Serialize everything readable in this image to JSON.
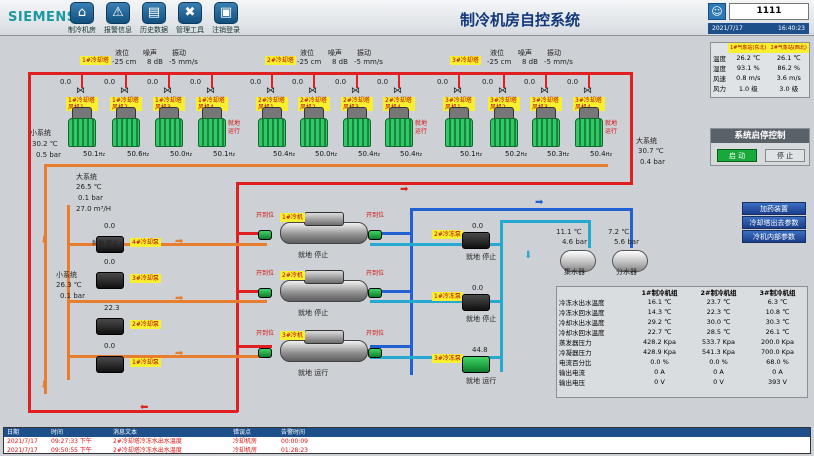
{
  "header": {
    "brand": "SIEMENS",
    "title": "制冷机房自控系统",
    "user": "1111",
    "date": "2021/7/17",
    "time": "16:40:23",
    "toolbar": [
      {
        "label": "制冷机房",
        "icon": "home-icon",
        "glyph": "⌂"
      },
      {
        "label": "报警信息",
        "icon": "warning-icon",
        "glyph": "⚠"
      },
      {
        "label": "历史数据",
        "icon": "folder-icon",
        "glyph": "▤"
      },
      {
        "label": "管理工具",
        "icon": "tools-icon",
        "glyph": "✖"
      },
      {
        "label": "注销登录",
        "icon": "lock-icon",
        "glyph": "▣"
      }
    ]
  },
  "groups": [
    {
      "name": "1#冷却塔",
      "level": "液位",
      "lvl_val": "-25 cm",
      "noise": "噪声",
      "noise_val": "8 dB",
      "vib": "振动",
      "vib_val": "-5 mm/s"
    },
    {
      "name": "2#冷却塔",
      "level": "液位",
      "lvl_val": "-25 cm",
      "noise": "噪声",
      "noise_val": "8 dB",
      "vib": "振动",
      "vib_val": "-5 mm/s"
    },
    {
      "name": "3#冷却塔",
      "level": "液位",
      "lvl_val": "-25 cm",
      "noise": "噪声",
      "noise_val": "8 dB",
      "vib": "振动",
      "vib_val": "-5 mm/s"
    }
  ],
  "towers": [
    {
      "label": "1#冷却塔风机1",
      "hz": "50.1",
      "valve": "0.0"
    },
    {
      "label": "1#冷却塔风机2",
      "hz": "50.6",
      "valve": "0.0"
    },
    {
      "label": "1#冷却塔风机3",
      "hz": "50.0",
      "valve": "0.0"
    },
    {
      "label": "1#冷却塔风机4",
      "hz": "50.1",
      "valve": "0.0"
    },
    {
      "label": "2#冷却塔风机1",
      "hz": "50.4",
      "valve": "0.0"
    },
    {
      "label": "2#冷却塔风机2",
      "hz": "50.0",
      "valve": "0.0"
    },
    {
      "label": "2#冷却塔风机3",
      "hz": "50.4",
      "valve": "0.0"
    },
    {
      "label": "2#冷却塔风机4",
      "hz": "50.4",
      "valve": "0.0"
    },
    {
      "label": "3#冷却塔风机1",
      "hz": "50.1",
      "valve": "0.0"
    },
    {
      "label": "3#冷却塔风机2",
      "hz": "50.2",
      "valve": "0.0"
    },
    {
      "label": "3#冷却塔风机3",
      "hz": "50.3",
      "valve": "0.0"
    },
    {
      "label": "3#冷却塔风机4",
      "hz": "50.4",
      "valve": "0.0"
    }
  ],
  "status_local": "就地",
  "status_run": "运行",
  "hz_unit": "Hz",
  "left_side": {
    "label": "小系统",
    "temp": "30.2 ℃",
    "pres": "0.5 bar"
  },
  "right_side": {
    "label": "大系统",
    "temp": "30.7 ℃",
    "pres": "0.4 bar"
  },
  "big_sys": {
    "label": "大系统",
    "temp": "26.5 ℃",
    "pres": "0.1 bar",
    "flow": "27.0 m³/H"
  },
  "small_sys": {
    "label": "小系统",
    "temp": "26.3 ℃",
    "pres": "0.1 bar"
  },
  "cw_pumps": [
    {
      "label": "4#冷却泵",
      "hz": "0.0",
      "state": "就地  停止"
    },
    {
      "label": "3#冷却泵",
      "hz": "0.0",
      "state": ""
    },
    {
      "label": "2#冷却泵",
      "hz": "22.3",
      "state": ""
    },
    {
      "label": "1#冷却泵",
      "hz": "0.0",
      "state": ""
    }
  ],
  "chillers": [
    {
      "label": "1#冷机",
      "state": "就地  停止"
    },
    {
      "label": "2#冷机",
      "state": "就地  停止"
    },
    {
      "label": "3#冷机",
      "state": "就地  运行"
    }
  ],
  "valve_open": "开到位",
  "chw_pumps": [
    {
      "label": "2#冷冻泵",
      "hz": "0.0",
      "state": "就地  停止"
    },
    {
      "label": "1#冷冻泵",
      "hz": "0.0",
      "state": "就地  停止"
    },
    {
      "label": "3#冷冻泵",
      "hz": "44.8",
      "state": "就地  运行"
    }
  ],
  "tanks": [
    {
      "label": "集水器",
      "temp": "11.1 ℃",
      "pres": "4.6 bar"
    },
    {
      "label": "分水器",
      "temp": "7.2 ℃",
      "pres": "5.6 bar"
    }
  ],
  "env": {
    "cols": [
      "1#气象站(东北)",
      "2#气象站(西北)"
    ],
    "rows": [
      [
        "温度",
        "26.2 ℃",
        "26.1 ℃"
      ],
      [
        "湿度",
        "93.1 %",
        "86.2 %"
      ],
      [
        "风速",
        "0.8 m/s",
        "3.6 m/s"
      ],
      [
        "风力",
        "1.0 级",
        "3.0 级"
      ]
    ]
  },
  "control": {
    "title": "系统启停控制",
    "start": "启 动",
    "stop": "停 止"
  },
  "side_buttons": [
    "加药装置",
    "冷却塔出去参数",
    "冷机内部参数"
  ],
  "chiller_table": {
    "cols": [
      "1#制冷机组",
      "2#制冷机组",
      "3#制冷机组"
    ],
    "rows": [
      [
        "冷冻水出水温度",
        "16.1 ℃",
        "23.7 ℃",
        "6.3 ℃"
      ],
      [
        "冷冻水回水温度",
        "14.3 ℃",
        "22.3 ℃",
        "10.8 ℃"
      ],
      [
        "冷却水出水温度",
        "29.2 ℃",
        "30.0 ℃",
        "30.3 ℃"
      ],
      [
        "冷却水回水温度",
        "22.7 ℃",
        "28.5 ℃",
        "26.1 ℃"
      ],
      [
        "蒸发器压力",
        "428.2 Kpa",
        "533.7 Kpa",
        "200.0 Kpa"
      ],
      [
        "冷凝器压力",
        "428.9 Kpa",
        "541.3 Kpa",
        "700.0 Kpa"
      ],
      [
        "电流百分比",
        "0.0 %",
        "0.0 %",
        "68.0 %"
      ],
      [
        "输出电流",
        "0 A",
        "0 A",
        "0 A"
      ],
      [
        "输出电压",
        "0 V",
        "0 V",
        "393 V"
      ]
    ]
  },
  "alarm": {
    "cols": [
      "日期",
      "时间",
      "消息文本",
      "错误点",
      "告警时间"
    ],
    "rows": [
      [
        "2021/7/17",
        "09:27:33  下午",
        "2#冷却塔冷冻水出水温度",
        "冷却机房",
        "00:00:09"
      ],
      [
        "2021/7/17",
        "09:50:55  下午",
        "2#冷却塔冷冻水出水温度",
        "冷却机房",
        "01:28:23"
      ]
    ]
  }
}
